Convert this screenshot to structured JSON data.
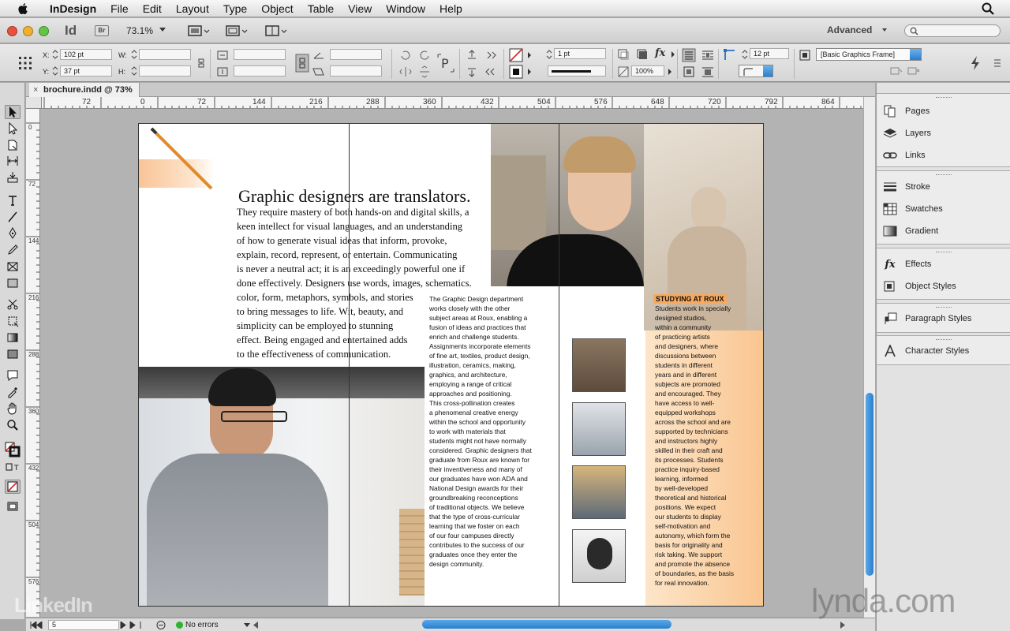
{
  "menubar": {
    "app": "InDesign",
    "items": [
      "File",
      "Edit",
      "Layout",
      "Type",
      "Object",
      "Table",
      "View",
      "Window",
      "Help"
    ]
  },
  "appbar": {
    "logo": "Id",
    "bridge": "Br",
    "zoom": "73.1%",
    "workspace": "Advanced"
  },
  "control": {
    "x_label": "X:",
    "x_value": "102 pt",
    "y_label": "Y:",
    "y_value": "37 pt",
    "w_label": "W:",
    "h_label": "H:",
    "stroke_weight": "1 pt",
    "opacity": "100%",
    "corner_size": "12 pt",
    "object_style": "[Basic Graphics Frame]"
  },
  "document": {
    "tab_title": "brochure.indd @ 73%"
  },
  "rulers": {
    "h": [
      "72",
      "0",
      "72",
      "144",
      "216",
      "288",
      "360",
      "432",
      "504",
      "576",
      "648",
      "720",
      "792",
      "864"
    ],
    "v": [
      "0",
      "72",
      "144",
      "216",
      "288",
      "360",
      "432",
      "504",
      "576"
    ]
  },
  "panels": {
    "group1": [
      "Pages",
      "Layers",
      "Links"
    ],
    "group2": [
      "Stroke",
      "Swatches",
      "Gradient"
    ],
    "group3": [
      "Effects",
      "Object Styles"
    ],
    "group4": [
      "Paragraph Styles"
    ],
    "group5": [
      "Character Styles"
    ]
  },
  "status": {
    "page": "5",
    "errors": "No errors"
  },
  "page": {
    "heading": "Graphic designers are translators.",
    "intro_lines": [
      "They require mastery of both hands-on and digital skills, a",
      "keen intellect for visual languages, and an understanding",
      "of how to generate visual ideas that inform, provoke,",
      "explain, record, represent, or entertain. Communicating",
      "is never a neutral act; it is an exceedingly powerful one if",
      "done effectively. Designers use words, images, schematics,",
      "color, form, metaphors, symbols, and stories",
      "to bring messages to life. Wit, beauty, and",
      "simplicity can be employed to stunning",
      "effect. Being engaged and entertained adds",
      "to the effectiveness of communication."
    ],
    "column_lines": [
      "The Graphic Design department",
      "works closely with the other",
      "subject areas at Roux, enabling a",
      "fusion of ideas and practices that",
      "enrich and challenge students.",
      "Assignments incorporate elements",
      "of fine art, textiles, product design,",
      "illustration, ceramics, making,",
      "graphics, and architecture,",
      "employing a range of critical",
      "approaches and positioning.",
      "This cross-pollination creates",
      "a phenomenal creative energy",
      "within the school and opportunity",
      "to work with materials that",
      "students might not have normally",
      "considered. Graphic designers that",
      "graduate from Roux are known for",
      "their inventiveness and many of",
      "our graduates have won ADA and",
      "National Design awards for their",
      "groundbreaking reconceptions",
      "of traditional objects. We believe",
      "that the type of cross-curricular",
      "learning that we foster on each",
      "of our four campuses directly",
      "contributes to the success of our",
      "graduates once they enter the",
      "design community."
    ],
    "studying_title": "STUDYING AT ROUX",
    "studying_lines": [
      "Students work in specially",
      "designed studios,",
      "within a community",
      "of practicing artists",
      "and designers, where",
      "discussions between",
      "students in different",
      "years and in different",
      "subjects are promoted",
      "and encouraged. They",
      "have access to well-",
      "equipped workshops",
      "across the school and are",
      "supported by technicians",
      "and instructors highly",
      "skilled in their craft and",
      "its processes. Students",
      "practice inquiry-based",
      "learning, informed",
      "by well-developed",
      "theoretical and historical",
      "positions. We expect",
      "our students to display",
      "self-motivation and",
      "autonomy, which form the",
      "basis for originality and",
      "risk taking. We support",
      "and promote the absence",
      "of boundaries, as the basis",
      "for real innovation."
    ]
  },
  "watermarks": {
    "left": "LinkedIn",
    "right": "lynda.com"
  },
  "colors": {
    "accent_orange": "#f7a960",
    "scroll_blue": "#2a7fd0"
  }
}
